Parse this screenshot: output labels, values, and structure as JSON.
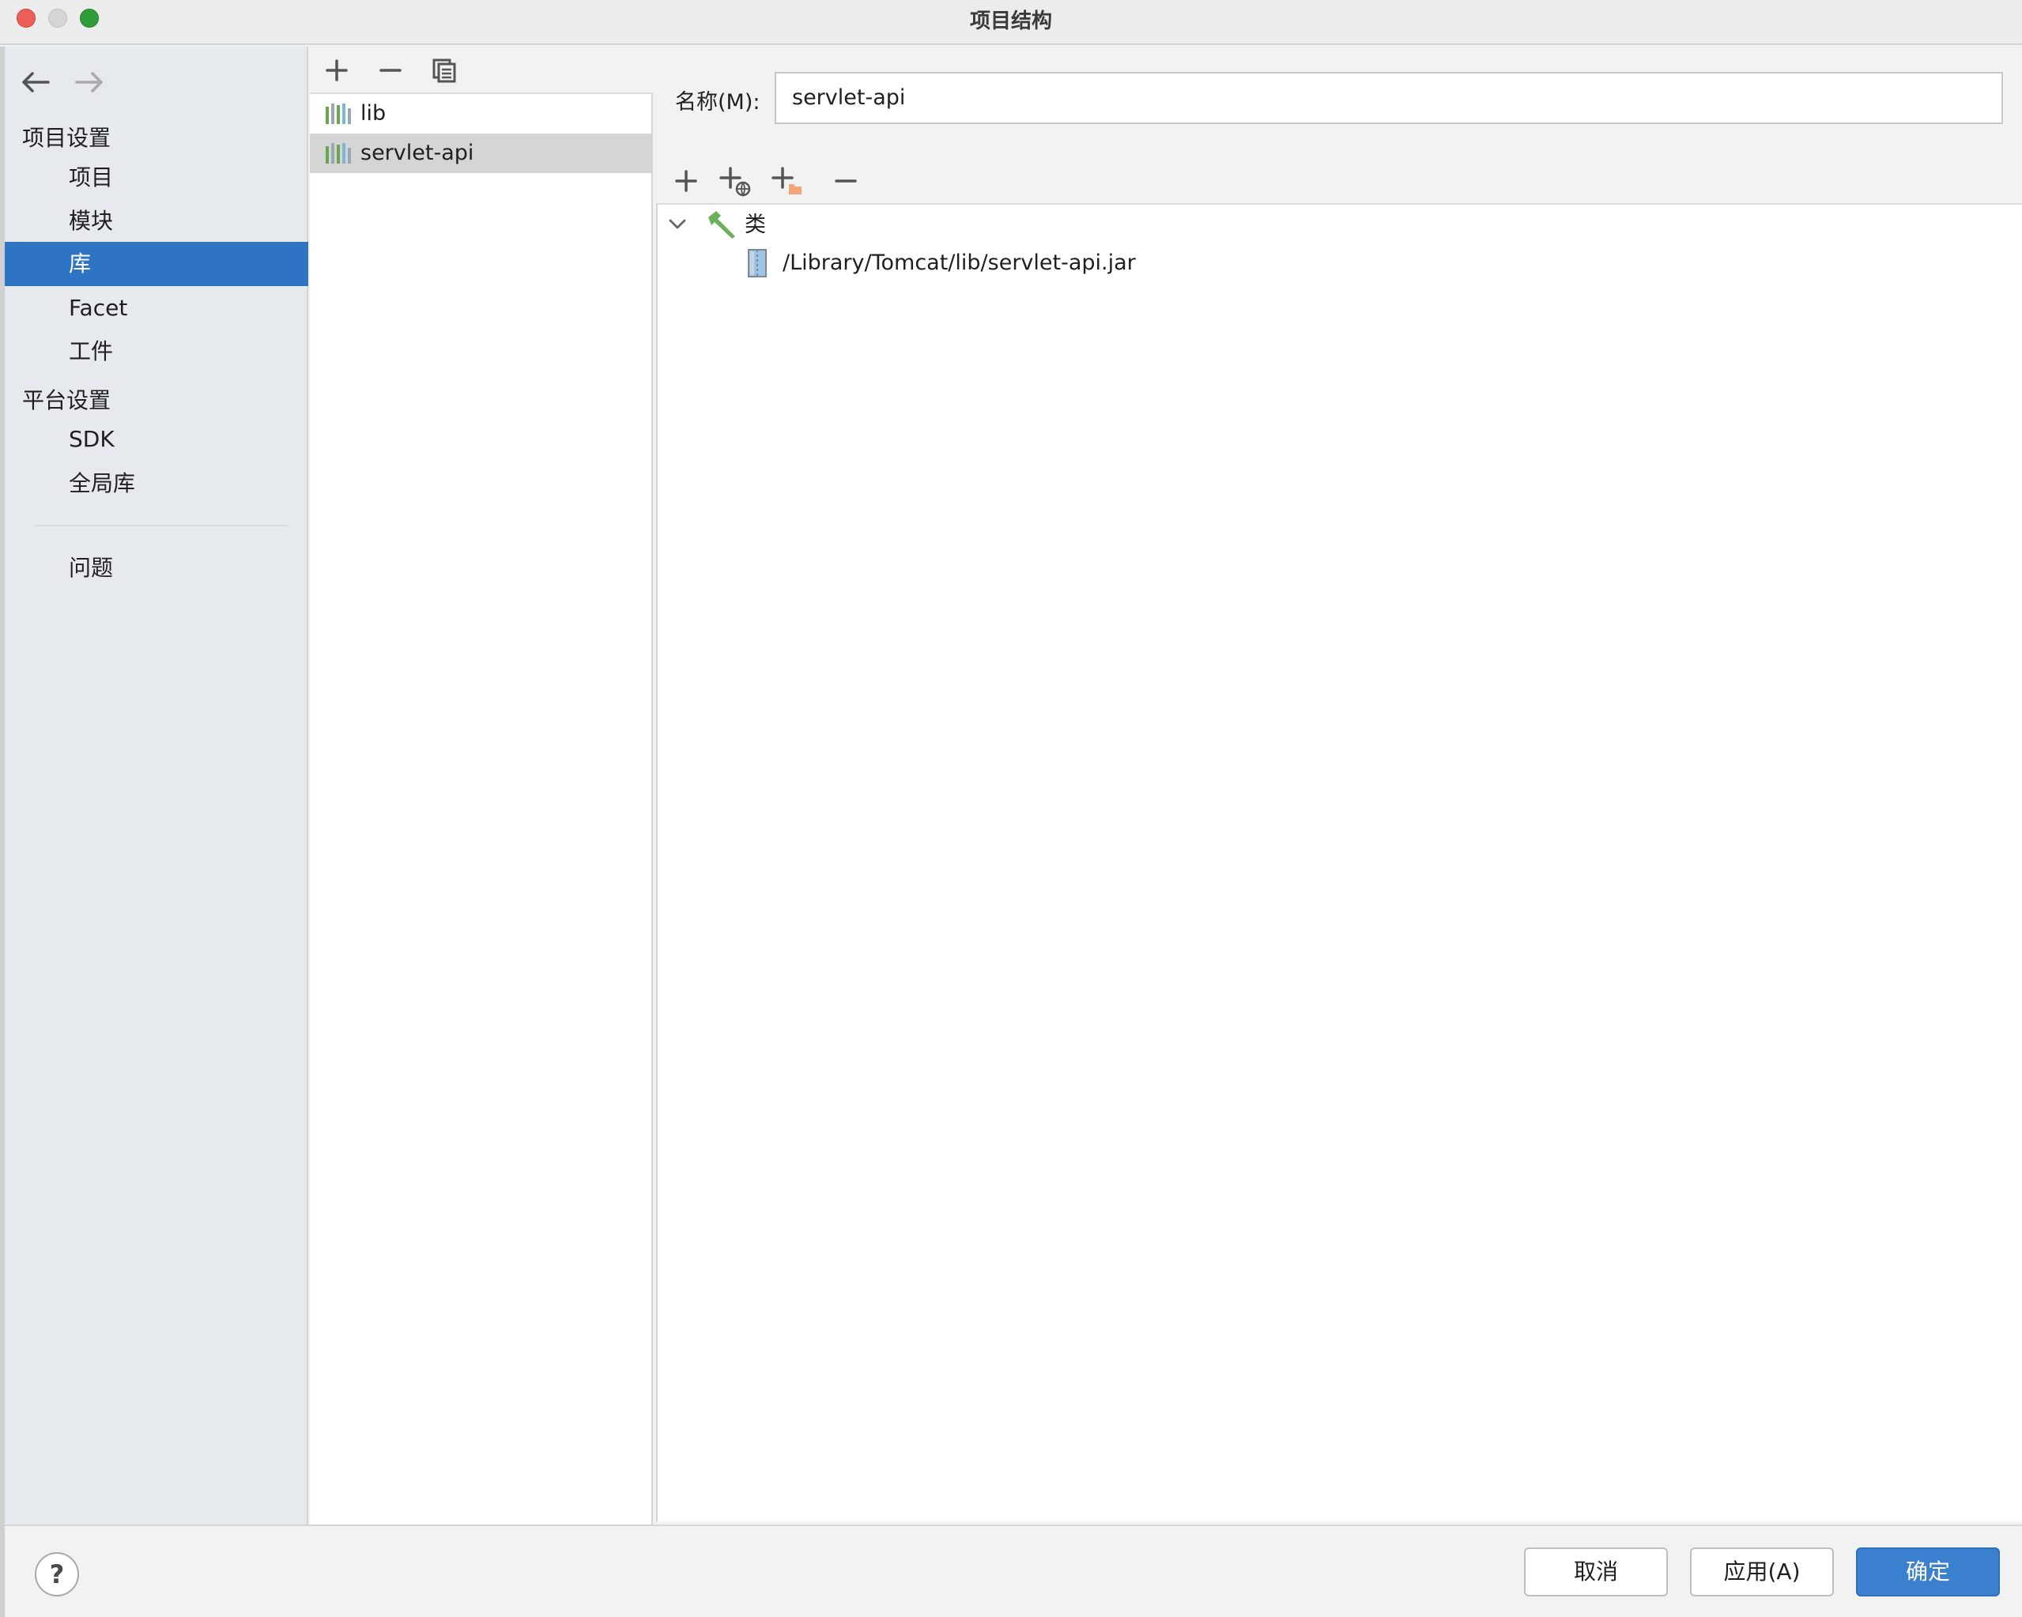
{
  "window": {
    "title": "项目结构"
  },
  "sidebar": {
    "section_project": "项目设置",
    "section_platform": "平台设置",
    "items": [
      {
        "label": "项目"
      },
      {
        "label": "模块"
      },
      {
        "label": "库"
      },
      {
        "label": "Facet"
      },
      {
        "label": "工件"
      },
      {
        "label": "SDK"
      },
      {
        "label": "全局库"
      },
      {
        "label": "问题"
      }
    ],
    "selected": "库"
  },
  "libraries": {
    "items": [
      {
        "label": "lib"
      },
      {
        "label": "servlet-api"
      }
    ],
    "selected": "servlet-api"
  },
  "detail": {
    "name_label": "名称(M):",
    "name_value": "servlet-api",
    "tree": {
      "root_label": "类",
      "child_path": "/Library/Tomcat/lib/servlet-api.jar"
    }
  },
  "buttons": {
    "help": "?",
    "cancel": "取消",
    "apply": "应用(A)",
    "ok": "确定"
  },
  "colors": {
    "selection_blue": "#2f74c2",
    "primary_button": "#3b80cf",
    "sidebar_bg": "#e6eaee"
  }
}
